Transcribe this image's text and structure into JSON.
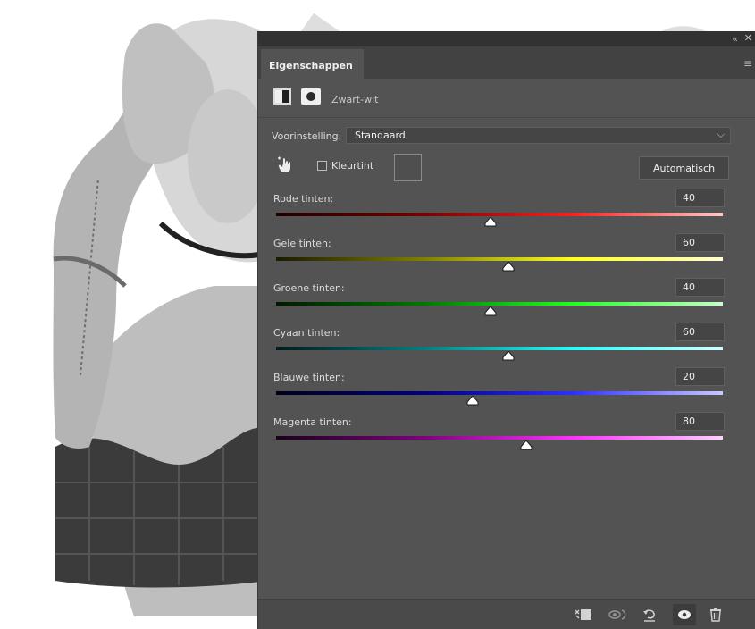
{
  "panel": {
    "tab_label": "Eigenschappen",
    "layer_name": "Zwart-wit",
    "preset_label": "Voorinstelling:",
    "preset_value": "Standaard",
    "tint_label": "Kleurtint",
    "tint_checked": false,
    "auto_label": "Automatisch",
    "sliders": [
      {
        "label": "Rode tinten:",
        "value": "40",
        "position": 0.48,
        "colors": [
          "#1a0000",
          "#7a0000",
          "#ff2020",
          "#ffc8c8"
        ]
      },
      {
        "label": "Gele tinten:",
        "value": "60",
        "position": 0.52,
        "colors": [
          "#1a1a00",
          "#808000",
          "#ffff20",
          "#ffffd0"
        ]
      },
      {
        "label": "Groene tinten:",
        "value": "40",
        "position": 0.48,
        "colors": [
          "#001a00",
          "#007a00",
          "#20ff20",
          "#c8ffc8"
        ]
      },
      {
        "label": "Cyaan tinten:",
        "value": "60",
        "position": 0.52,
        "colors": [
          "#001a1a",
          "#008080",
          "#20ffff",
          "#d0ffff"
        ]
      },
      {
        "label": "Blauwe tinten:",
        "value": "20",
        "position": 0.44,
        "colors": [
          "#00001a",
          "#00007a",
          "#3030ff",
          "#c8c8ff"
        ]
      },
      {
        "label": "Magenta tinten:",
        "value": "80",
        "position": 0.56,
        "colors": [
          "#1a001a",
          "#800080",
          "#ff30ff",
          "#ffd0ff"
        ]
      }
    ]
  },
  "footer_icons": [
    "clip-to-layer-icon",
    "view-previous-state-icon",
    "reset-icon",
    "visibility-icon",
    "delete-icon"
  ]
}
